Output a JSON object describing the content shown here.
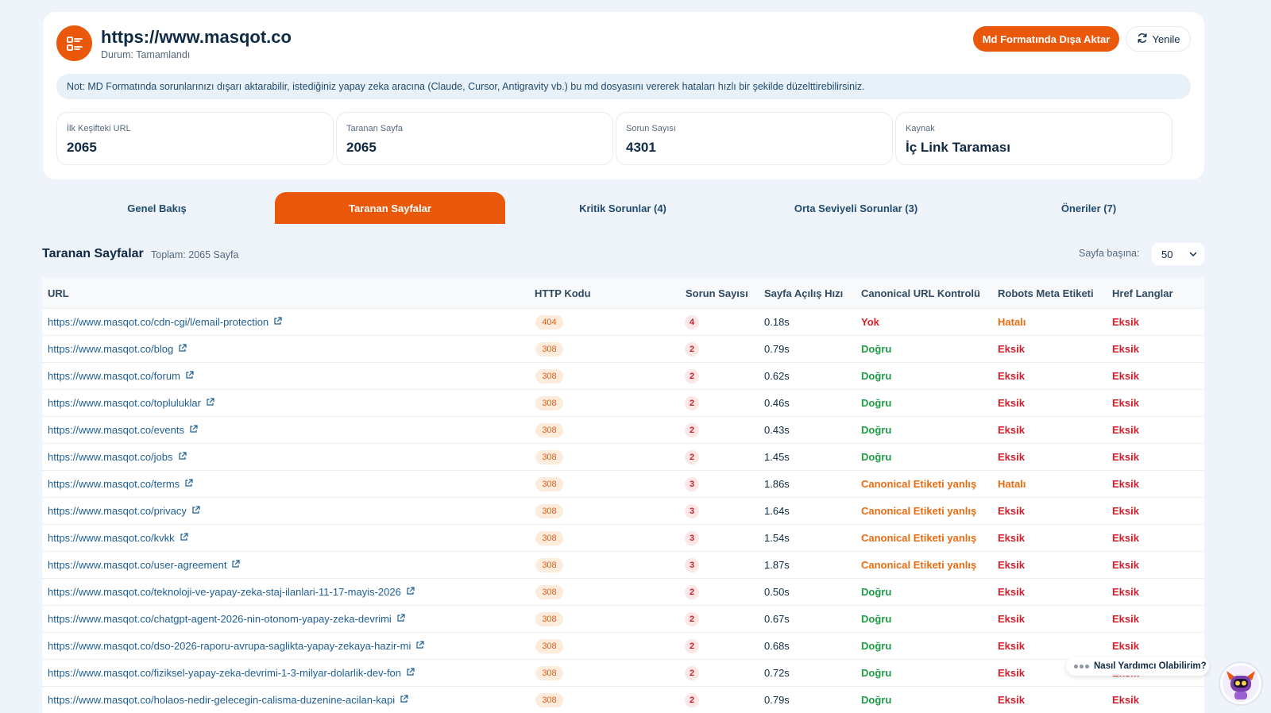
{
  "header": {
    "site_url": "https://www.masqot.co",
    "status": "Durum: Tamamlandı",
    "export_label": "Md Formatında Dışa Aktar",
    "refresh_label": "Yenile",
    "note": "Not: MD Formatında sorunlarınızı dışarı aktarabilir, istediğiniz yapay zeka aracına (Claude, Cursor, Antigravity vb.) bu md dosyasını vererek hataları hızlı bir şekilde düzelttirebilirsiniz.",
    "stats": [
      {
        "label": "İlk Keşifteki URL",
        "value": "2065"
      },
      {
        "label": "Taranan Sayfa",
        "value": "2065"
      },
      {
        "label": "Sorun Sayısı",
        "value": "4301"
      },
      {
        "label": "Kaynak",
        "value": "İç Link Taraması"
      }
    ]
  },
  "tabs": [
    {
      "label": "Genel Bakış",
      "active": false
    },
    {
      "label": "Taranan Sayfalar",
      "active": true
    },
    {
      "label": "Kritik Sorunlar (4)",
      "active": false
    },
    {
      "label": "Orta Seviyeli Sorunlar (3)",
      "active": false
    },
    {
      "label": "Öneriler (7)",
      "active": false
    }
  ],
  "section": {
    "title": "Taranan Sayfalar",
    "total": "Toplam: 2065 Sayfa",
    "per_page_label": "Sayfa başına:",
    "per_page_value": "50"
  },
  "table": {
    "columns": [
      "URL",
      "HTTP Kodu",
      "Sorun Sayısı",
      "Sayfa Açılış Hızı",
      "Canonical URL Kontrolü",
      "Robots Meta Etiketi",
      "Href Langlar"
    ],
    "rows": [
      {
        "url": "https://www.masqot.co/cdn-cgi/l/email-protection",
        "code": "404",
        "issues": "4",
        "speed": "0.18s",
        "canonical": "Yok",
        "robots": "Hatalı",
        "href": "Eksik"
      },
      {
        "url": "https://www.masqot.co/blog",
        "code": "308",
        "issues": "2",
        "speed": "0.79s",
        "canonical": "Doğru",
        "robots": "Eksik",
        "href": "Eksik"
      },
      {
        "url": "https://www.masqot.co/forum",
        "code": "308",
        "issues": "2",
        "speed": "0.62s",
        "canonical": "Doğru",
        "robots": "Eksik",
        "href": "Eksik"
      },
      {
        "url": "https://www.masqot.co/topluluklar",
        "code": "308",
        "issues": "2",
        "speed": "0.46s",
        "canonical": "Doğru",
        "robots": "Eksik",
        "href": "Eksik"
      },
      {
        "url": "https://www.masqot.co/events",
        "code": "308",
        "issues": "2",
        "speed": "0.43s",
        "canonical": "Doğru",
        "robots": "Eksik",
        "href": "Eksik"
      },
      {
        "url": "https://www.masqot.co/jobs",
        "code": "308",
        "issues": "2",
        "speed": "1.45s",
        "canonical": "Doğru",
        "robots": "Eksik",
        "href": "Eksik"
      },
      {
        "url": "https://www.masqot.co/terms",
        "code": "308",
        "issues": "3",
        "speed": "1.86s",
        "canonical": "Canonical Etiketi yanlış",
        "robots": "Hatalı",
        "href": "Eksik"
      },
      {
        "url": "https://www.masqot.co/privacy",
        "code": "308",
        "issues": "3",
        "speed": "1.64s",
        "canonical": "Canonical Etiketi yanlış",
        "robots": "Eksik",
        "href": "Eksik"
      },
      {
        "url": "https://www.masqot.co/kvkk",
        "code": "308",
        "issues": "3",
        "speed": "1.54s",
        "canonical": "Canonical Etiketi yanlış",
        "robots": "Eksik",
        "href": "Eksik"
      },
      {
        "url": "https://www.masqot.co/user-agreement",
        "code": "308",
        "issues": "3",
        "speed": "1.87s",
        "canonical": "Canonical Etiketi yanlış",
        "robots": "Eksik",
        "href": "Eksik"
      },
      {
        "url": "https://www.masqot.co/teknoloji-ve-yapay-zeka-staj-ilanlari-11-17-mayis-2026",
        "code": "308",
        "issues": "2",
        "speed": "0.50s",
        "canonical": "Doğru",
        "robots": "Eksik",
        "href": "Eksik"
      },
      {
        "url": "https://www.masqot.co/chatgpt-agent-2026-nin-otonom-yapay-zeka-devrimi",
        "code": "308",
        "issues": "2",
        "speed": "0.67s",
        "canonical": "Doğru",
        "robots": "Eksik",
        "href": "Eksik"
      },
      {
        "url": "https://www.masqot.co/dso-2026-raporu-avrupa-saglikta-yapay-zekaya-hazir-mi",
        "code": "308",
        "issues": "2",
        "speed": "0.68s",
        "canonical": "Doğru",
        "robots": "Eksik",
        "href": "Eksik"
      },
      {
        "url": "https://www.masqot.co/fiziksel-yapay-zeka-devrimi-1-3-milyar-dolarlik-dev-fon",
        "code": "308",
        "issues": "2",
        "speed": "0.72s",
        "canonical": "Doğru",
        "robots": "Eksik",
        "href": "Eksik"
      },
      {
        "url": "https://www.masqot.co/holaos-nedir-gelecegin-calisma-duzenine-acilan-kapi",
        "code": "308",
        "issues": "2",
        "speed": "0.79s",
        "canonical": "Doğru",
        "robots": "Eksik",
        "href": "Eksik"
      }
    ]
  },
  "chat": {
    "prompt": "Nasıl Yardımcı Olabilirim?"
  },
  "colors": {
    "accent": "#ea580c",
    "error_red": "#d41e2a",
    "ok_green": "#1f9d45",
    "warn_orange": "#ea6b10"
  },
  "icons": [
    "list-icon",
    "refresh-icon",
    "external-link-icon",
    "chevron-down-icon",
    "robot-avatar-icon"
  ]
}
